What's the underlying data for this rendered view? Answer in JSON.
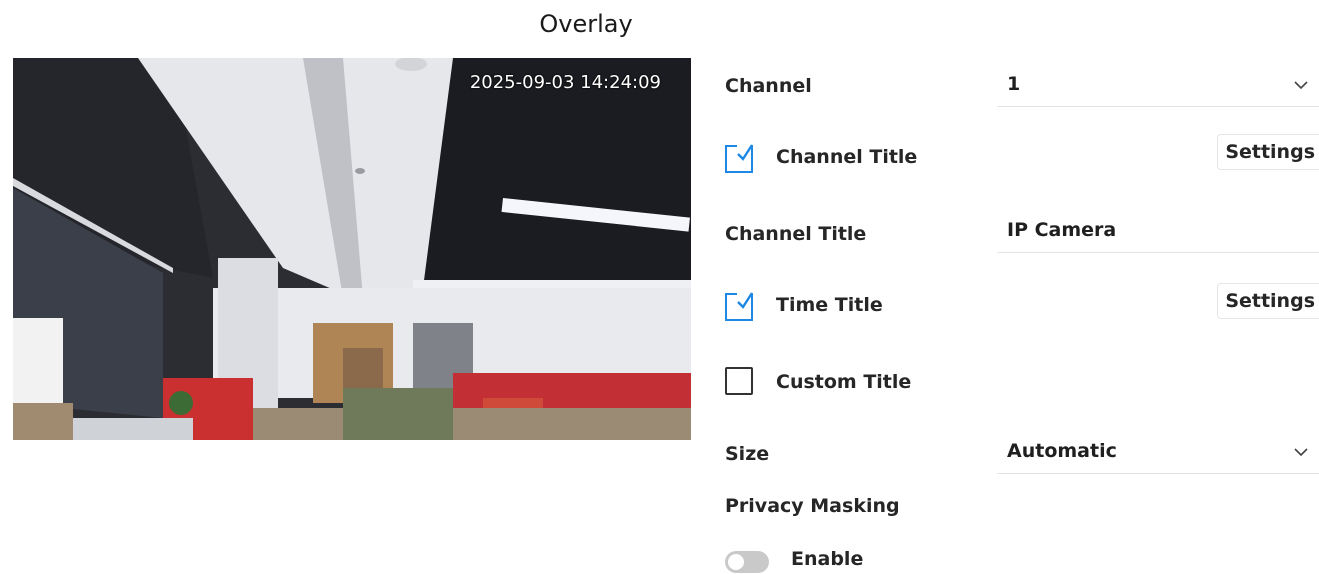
{
  "page": {
    "title": "Overlay"
  },
  "preview": {
    "timestamp": "2025-09-03 14:24:09"
  },
  "settings": {
    "channel": {
      "label": "Channel",
      "value": "1"
    },
    "channel_title_toggle": {
      "label": "Channel Title",
      "checked": true,
      "button": "Settings"
    },
    "channel_title_field": {
      "label": "Channel Title",
      "value": "IP Camera"
    },
    "time_title_toggle": {
      "label": "Time Title",
      "checked": true,
      "button": "Settings"
    },
    "custom_title": {
      "label": "Custom Title",
      "checked": false
    },
    "size": {
      "label": "Size",
      "value": "Automatic"
    },
    "privacy": {
      "label": "Privacy Masking",
      "enable_label": "Enable",
      "enabled": false
    }
  },
  "icons": {
    "checked": "checkbox-checked-icon",
    "unchecked": "checkbox-empty-icon",
    "dropdown": "chevron-down-icon"
  },
  "colors": {
    "accent": "#1e88e5",
    "toggle_off": "#c9c9c9"
  }
}
